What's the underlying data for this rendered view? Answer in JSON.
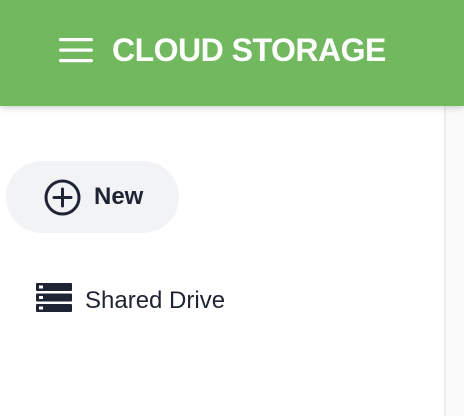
{
  "header": {
    "title": "CLOUD STORAGE",
    "menu_icon": "hamburger-menu-icon",
    "background_color": "#72b85f",
    "text_color": "#ffffff"
  },
  "sidebar": {
    "new_button": {
      "label": "New",
      "icon": "add-circle-icon",
      "background_color": "#f1f3f4"
    },
    "items": [
      {
        "label": "Shared Drive",
        "icon": "storage-icon"
      }
    ]
  }
}
